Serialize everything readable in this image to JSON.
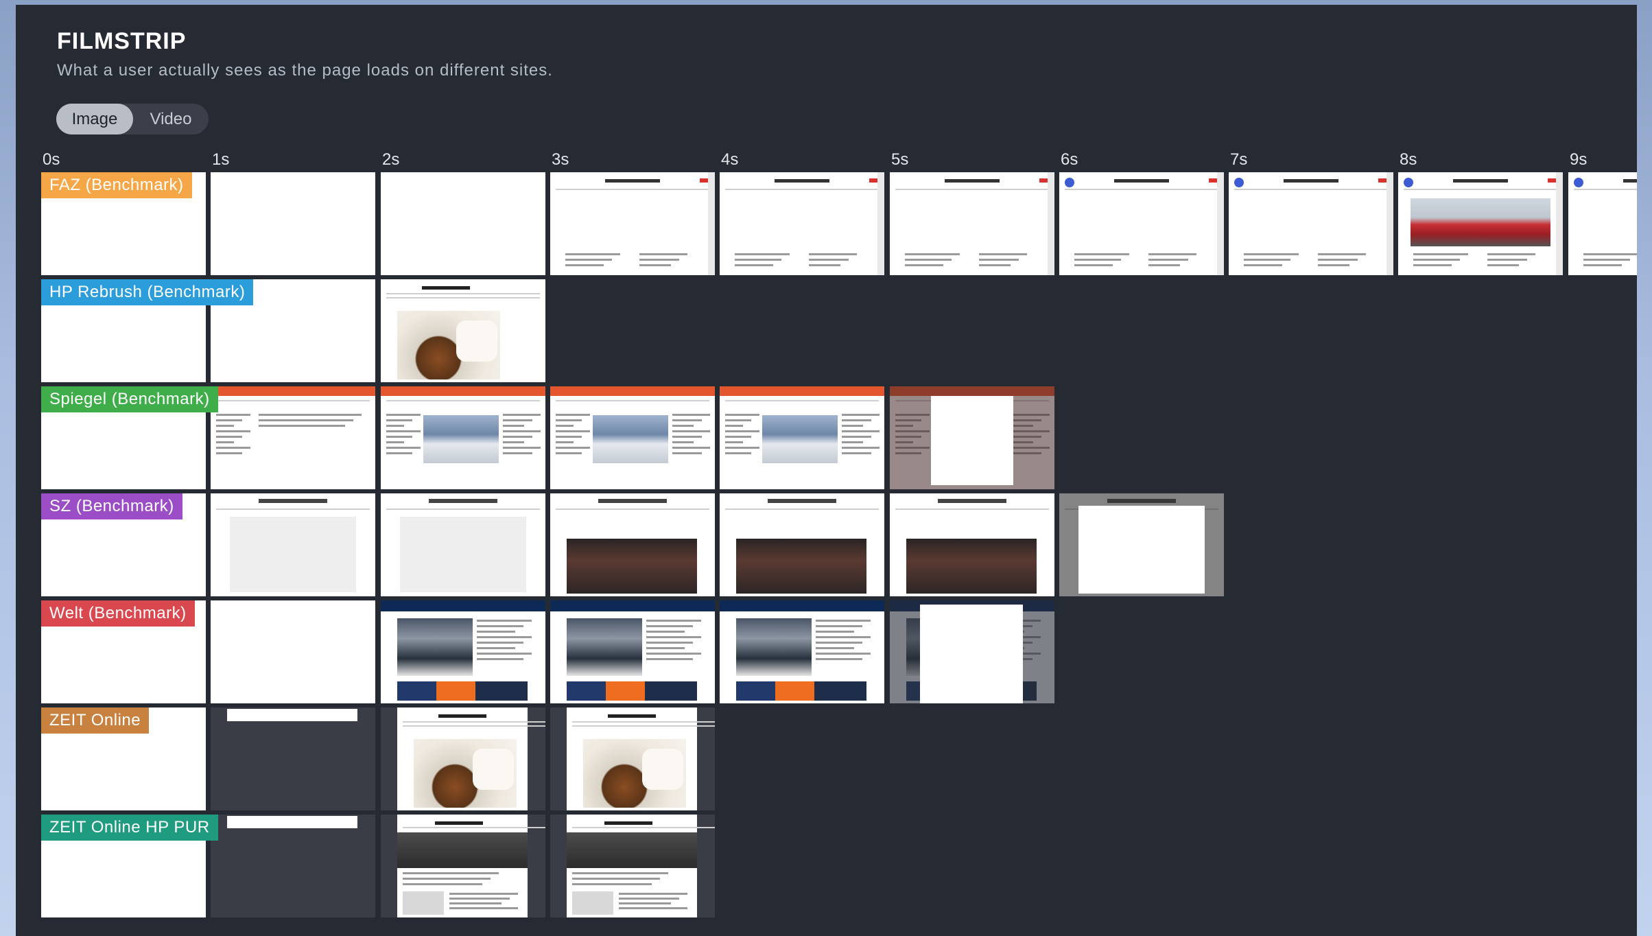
{
  "header": {
    "title": "FILMSTRIP",
    "subtitle": "What a user actually sees as the page loads on different sites."
  },
  "toggle": {
    "image_label": "Image",
    "video_label": "Video",
    "selected": "Image"
  },
  "colors": {
    "panel_bg": "#262a33",
    "faz": "#f5a646",
    "hp_rebrush": "#2b9ddb",
    "spiegel": "#3fae4a",
    "sz": "#9b4dc6",
    "welt": "#d9474f",
    "zeit_online": "#c8813f",
    "zeit_hp_pur": "#1f9b7f"
  },
  "timeline": {
    "ticks": [
      "0s",
      "1s",
      "2s",
      "3s",
      "4s",
      "5s",
      "6s",
      "7s",
      "8s",
      "9s"
    ]
  },
  "rows": [
    {
      "label": "FAZ (Benchmark)",
      "color_key": "faz",
      "frames": [
        "blank",
        "blank",
        "blank",
        "faz",
        "faz",
        "faz",
        "faz-logo",
        "faz-logo",
        "faz-train",
        "faz-partial"
      ]
    },
    {
      "label": "HP Rebrush (Benchmark)",
      "color_key": "hp_rebrush",
      "frames": [
        "blank",
        "blank",
        "zeit-chip"
      ]
    },
    {
      "label": "Spiegel (Benchmark)",
      "color_key": "spiegel",
      "frames": [
        "blank",
        "spiegel-text",
        "spiegel",
        "spiegel",
        "spiegel",
        "spiegel-modal"
      ]
    },
    {
      "label": "SZ (Benchmark)",
      "color_key": "sz",
      "frames": [
        "blank",
        "sz-empty",
        "sz-empty",
        "sz",
        "sz",
        "sz",
        "sz-modal"
      ]
    },
    {
      "label": "Welt (Benchmark)",
      "color_key": "welt",
      "frames": [
        "blank",
        "blank",
        "welt",
        "welt",
        "welt",
        "welt-modal"
      ]
    },
    {
      "label": "ZEIT Online",
      "color_key": "zeit_online",
      "frames": [
        "blank",
        "dark-bar",
        "zeit-chip-dark",
        "zeit-chip-dark"
      ]
    },
    {
      "label": "ZEIT Online HP PUR",
      "color_key": "zeit_hp_pur",
      "frames": [
        "blank",
        "dark-bar",
        "zeit-pur",
        "zeit-pur"
      ]
    }
  ]
}
